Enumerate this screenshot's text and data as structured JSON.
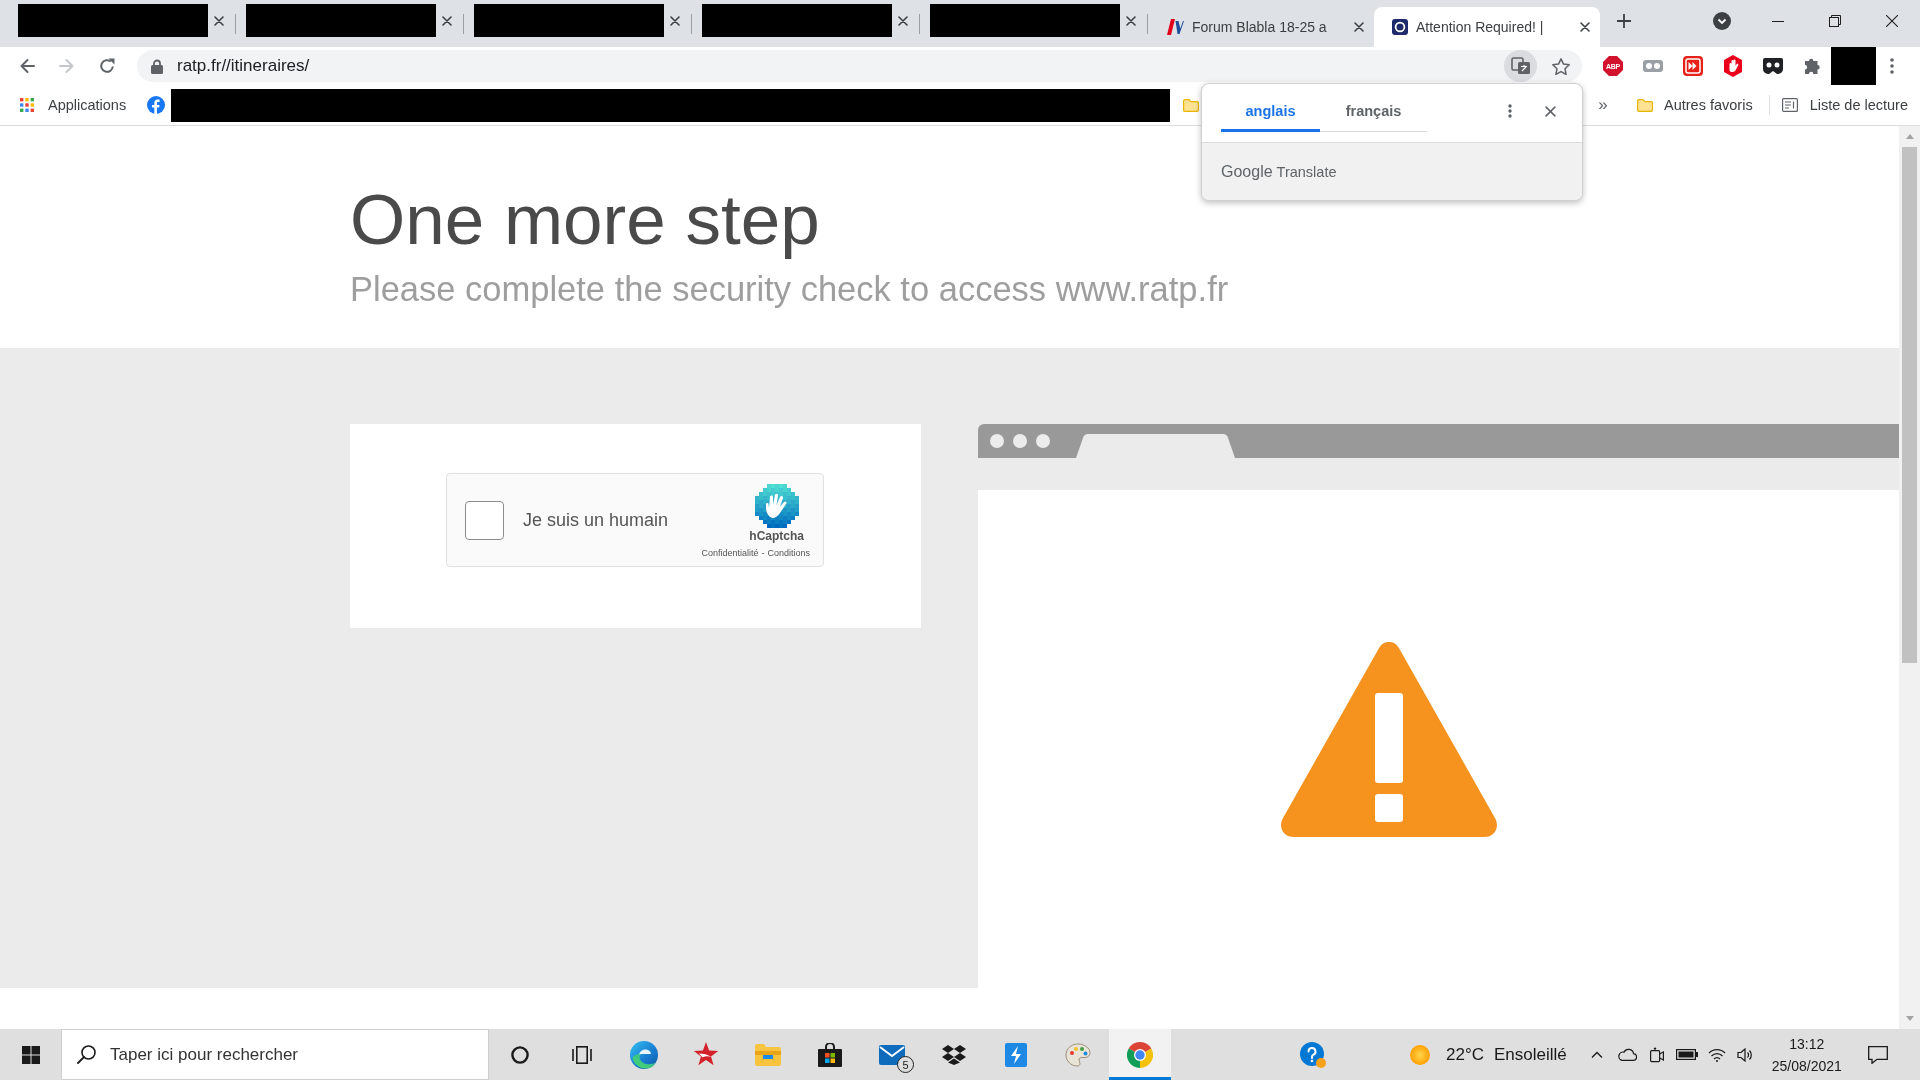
{
  "browser": {
    "tabs": [
      {
        "kind": "redacted",
        "selected": false
      },
      {
        "kind": "redacted",
        "selected": false
      },
      {
        "kind": "redacted",
        "selected": false
      },
      {
        "kind": "redacted",
        "selected": false
      },
      {
        "kind": "redacted",
        "selected": false
      },
      {
        "kind": "page",
        "title": "Forum Blabla 18-25 a",
        "selected": false
      },
      {
        "kind": "page",
        "title": "Attention Required! |",
        "selected": true
      }
    ],
    "navigation": {
      "back": {
        "disabled": false
      },
      "forward": {
        "disabled": true
      }
    },
    "address_bar": {
      "url": "ratp.fr//itineraires/"
    },
    "extensions": [
      {
        "kind": "abp",
        "label": "ABP"
      },
      {
        "kind": "glasses"
      },
      {
        "kind": "fast-forward"
      },
      {
        "kind": "hand"
      },
      {
        "kind": "mask"
      },
      {
        "kind": "puzzle"
      },
      {
        "kind": "redacted"
      }
    ],
    "bookmarks": [
      {
        "kind": "apps",
        "label": "Applications"
      },
      {
        "kind": "facebook"
      },
      {
        "kind": "redacted"
      },
      {
        "kind": "folder"
      }
    ],
    "bookmarks_overflow": "»",
    "other_bookmarks": {
      "label": "Autres favoris"
    },
    "reading_list": {
      "label": "Liste de lecture"
    }
  },
  "translate_popup": {
    "languages": [
      {
        "label": "anglais",
        "selected": true
      },
      {
        "label": "français",
        "selected": false
      }
    ],
    "logo": "Google",
    "label": "Translate"
  },
  "page": {
    "heading": "One more step",
    "subheading": "Please complete the security check to access www.ratp.fr",
    "captcha": {
      "checked": false,
      "label": "Je suis un humain",
      "brand": "hCaptcha",
      "links": [
        "Confidentialité",
        "Conditions"
      ],
      "separator": "-"
    }
  },
  "taskbar": {
    "search_placeholder": "Taper ici pour rechercher",
    "apps": [
      {
        "kind": "edge",
        "active": false
      },
      {
        "kind": "star-app",
        "active": false
      },
      {
        "kind": "file-explorer",
        "active": false
      },
      {
        "kind": "store",
        "active": false
      },
      {
        "kind": "mail",
        "active": false,
        "badge": "5"
      },
      {
        "kind": "dropbox",
        "active": false
      },
      {
        "kind": "lightning-app",
        "active": false
      },
      {
        "kind": "paint",
        "active": false
      },
      {
        "kind": "chrome",
        "active": true
      }
    ],
    "weather": {
      "temperature": "22°C",
      "condition": "Ensoleillé"
    },
    "clock": {
      "time": "13:12",
      "date": "25/08/2021"
    }
  }
}
